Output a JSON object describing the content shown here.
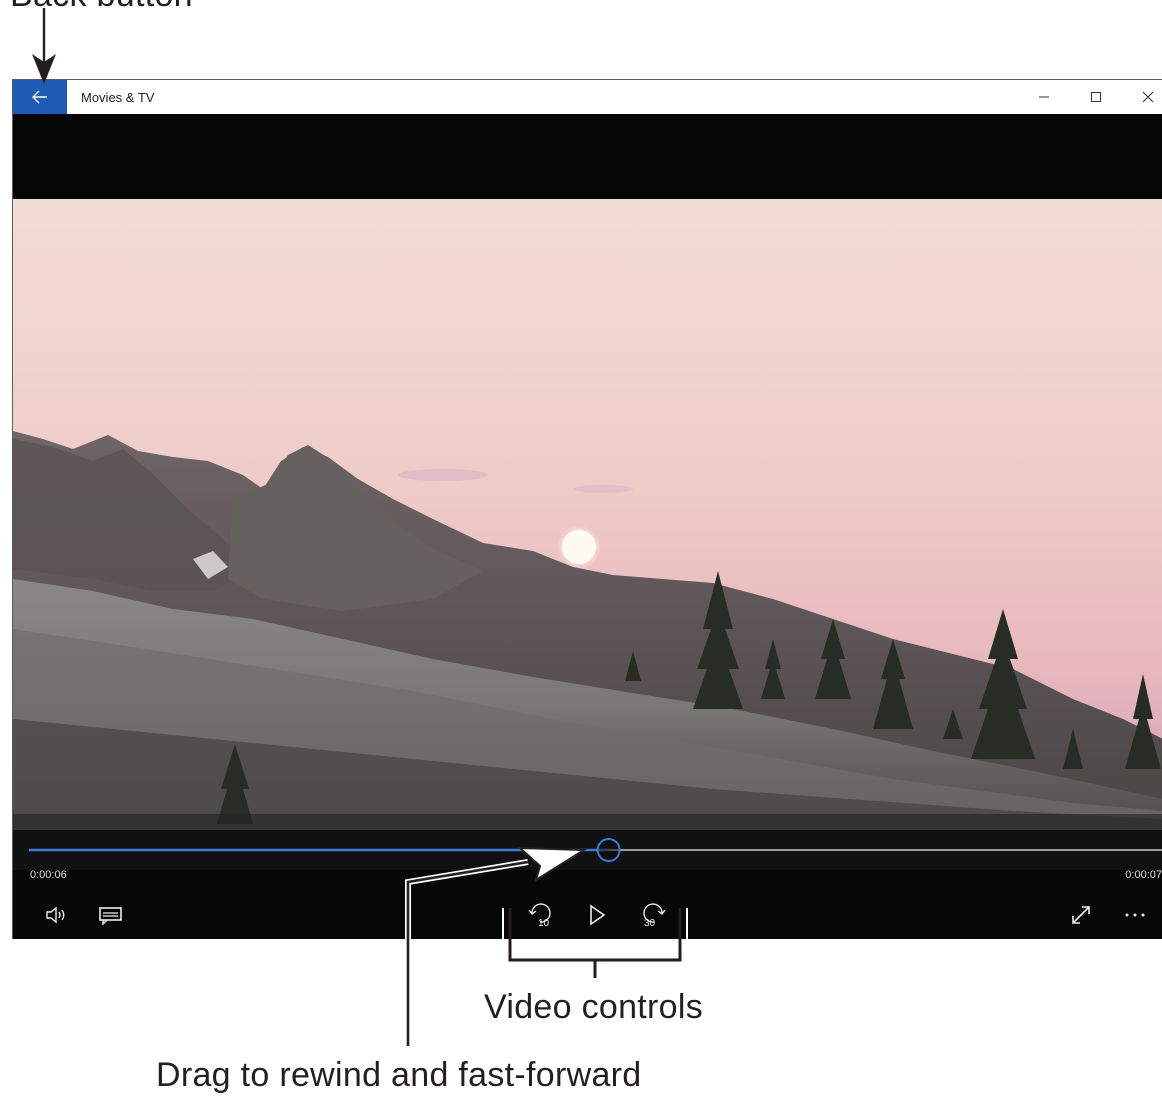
{
  "callouts": {
    "back_button": "Back button",
    "video_controls": "Video controls",
    "drag": "Drag to rewind and fast-forward"
  },
  "window": {
    "title": "Movies & TV",
    "back_icon": "arrow-left-icon",
    "minimize_icon": "minimize-icon",
    "maximize_icon": "maximize-icon",
    "close_icon": "close-icon"
  },
  "player": {
    "time_current": "0:00:06",
    "time_total": "0:00:07",
    "progress_fraction": 0.49,
    "accent": "#1f5bb5",
    "skip_back_label": "10",
    "skip_forward_label": "30",
    "controls": {
      "volume_icon": "volume-icon",
      "captions_icon": "captions-icon",
      "skip_back_icon": "skip-back-10-icon",
      "play_icon": "play-icon",
      "skip_forward_icon": "skip-forward-30-icon",
      "fullscreen_icon": "fullscreen-icon",
      "more_icon": "more-options-icon"
    }
  }
}
